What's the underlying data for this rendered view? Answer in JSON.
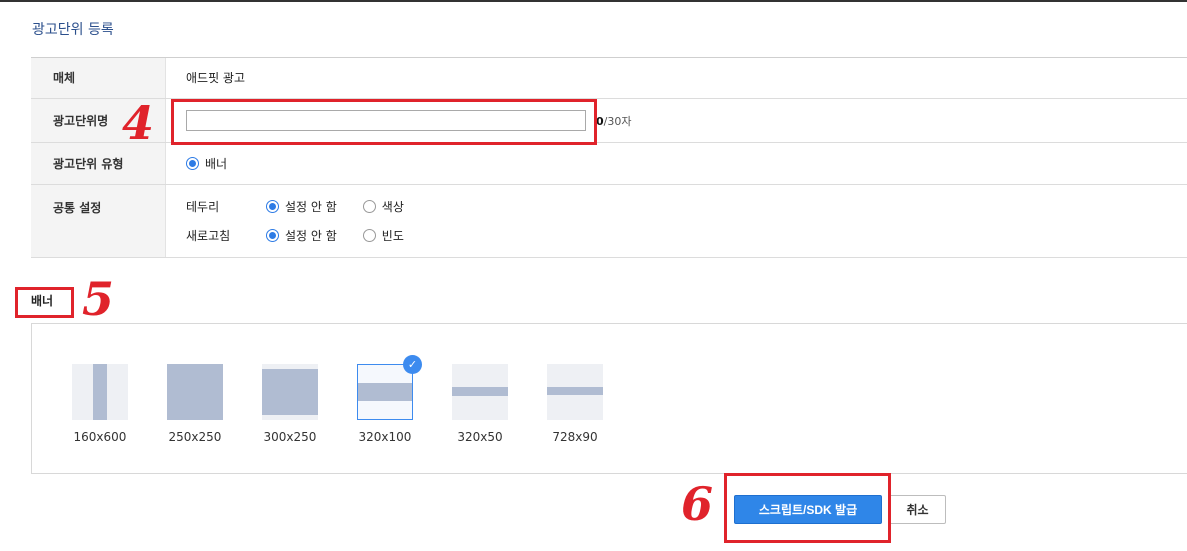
{
  "page": {
    "title": "광고단위 등록"
  },
  "form": {
    "media": {
      "label": "매체",
      "value": "애드핏 광고"
    },
    "unit_name": {
      "label": "광고단위명",
      "value": "",
      "placeholder": "",
      "counter_current": "0",
      "counter_max": "/30자"
    },
    "unit_type": {
      "label": "광고단위 유형",
      "option": "배너"
    },
    "common": {
      "label": "공통 설정",
      "border": {
        "label": "테두리",
        "options": [
          "설정 안 함",
          "색상"
        ],
        "selected": "설정 안 함"
      },
      "refresh": {
        "label": "새로고침",
        "options": [
          "설정 안 함",
          "빈도"
        ],
        "selected": "설정 안 함"
      }
    }
  },
  "banner": {
    "heading": "배너",
    "sizes": [
      {
        "label": "160x600",
        "selected": false
      },
      {
        "label": "250x250",
        "selected": false
      },
      {
        "label": "300x250",
        "selected": false
      },
      {
        "label": "320x100",
        "selected": true
      },
      {
        "label": "320x50",
        "selected": false
      },
      {
        "label": "728x90",
        "selected": false
      }
    ]
  },
  "actions": {
    "submit_label": "스크립트/SDK 발급",
    "cancel_label": "취소"
  },
  "annotations": {
    "num4": "4",
    "num5": "5",
    "num6": "6"
  },
  "colors": {
    "accent": "#2f86e8",
    "annotation": "#e0232b",
    "thumb": "#b0bcd2"
  },
  "icons": {
    "check": "check-icon"
  }
}
